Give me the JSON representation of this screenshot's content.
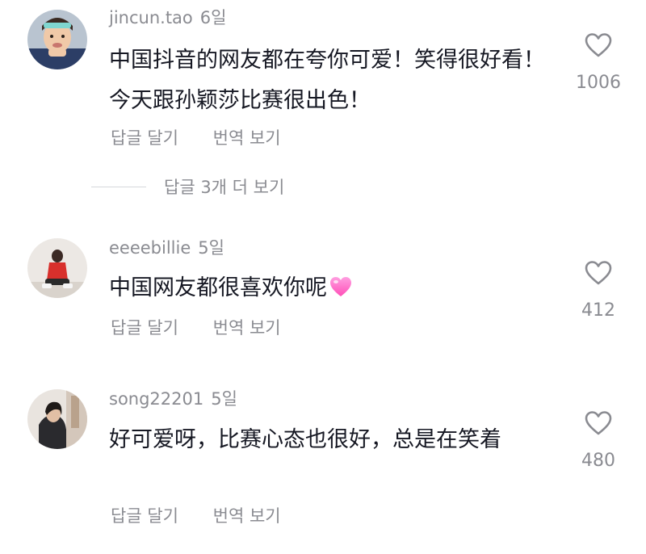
{
  "comments": [
    {
      "username": "jincun.tao",
      "time": "6일",
      "text": "中国抖音的网友都在夸你可爱！笑得很好看！今天跟孙颖莎比赛很出色！",
      "reply_label": "답글 달기",
      "translate_label": "번역 보기",
      "likes": "1006",
      "avatar": "girl-with-headband-avatar"
    },
    {
      "username": "eeeebillie",
      "time": "5일",
      "text": "中国网友都很喜欢你呢",
      "emoji": "pink-heart-emoji",
      "reply_label": "답글 달기",
      "translate_label": "번역 보기",
      "likes": "412",
      "avatar": "sitting-person-red-jacket-avatar"
    },
    {
      "username": "song22201",
      "time": "5일",
      "text": "好可爱呀，比赛心态也很好，总是在笑着",
      "reply_label": "답글 달기",
      "translate_label": "번역 보기",
      "likes": "480",
      "avatar": "woman-selfie-avatar"
    }
  ],
  "more_replies_label": "답글 3개 더 보기",
  "icons": {
    "like": "heart-outline-icon"
  },
  "colors": {
    "secondary_text": "#8a8b91",
    "primary_text": "#161823",
    "emoji_pink": "#ff6fc8"
  }
}
